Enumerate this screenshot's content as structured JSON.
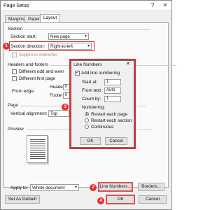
{
  "window": {
    "title": "Page Setup",
    "help": "?",
    "close": "✕"
  },
  "tabs": [
    "Margins",
    "Paper",
    "Layout"
  ],
  "section": {
    "heading": "Section",
    "start_label": "Section start:",
    "start_value": "New page",
    "direction_label": "Section direction:",
    "direction_value": "Right-to-left",
    "suppress_label": "Suppress endnotes"
  },
  "headers_footers": {
    "heading": "Headers and footers",
    "odd_even_label": "Different odd and even",
    "first_page_label": "Different first page",
    "from_edge_label": "From edge:",
    "header_label": "Header:",
    "header_value": "0",
    "footer_label": "Footer:",
    "footer_value": "0"
  },
  "page": {
    "heading": "Page",
    "valign_label": "Vertical alignment:",
    "valign_value": "Top"
  },
  "preview": {
    "heading": "Preview"
  },
  "apply": {
    "label": "Apply to:",
    "value": "Whole document"
  },
  "buttons": {
    "line_numbers": "Line Numbers...",
    "borders": "Borders...",
    "set_default": "Set As Default",
    "ok": "OK",
    "cancel": "Cancel"
  },
  "line_numbers_dialog": {
    "title": "Line Numbers",
    "close": "✕",
    "add_label": "Add line numbering",
    "start_at_label": "Start at:",
    "start_at_value": "1",
    "from_text_label": "From text:",
    "from_text_value": "Auto",
    "count_by_label": "Count by:",
    "count_by_value": "1",
    "numbering_label": "Numbering:",
    "options": [
      "Restart each page",
      "Restart each section",
      "Continuous"
    ],
    "ok": "OK",
    "cancel": "Cancel"
  },
  "badges": [
    "1",
    "2",
    "3",
    "4"
  ],
  "colors": {
    "annotation_red": "#e52e2e",
    "dialog_bg": "#f0f0f0"
  }
}
